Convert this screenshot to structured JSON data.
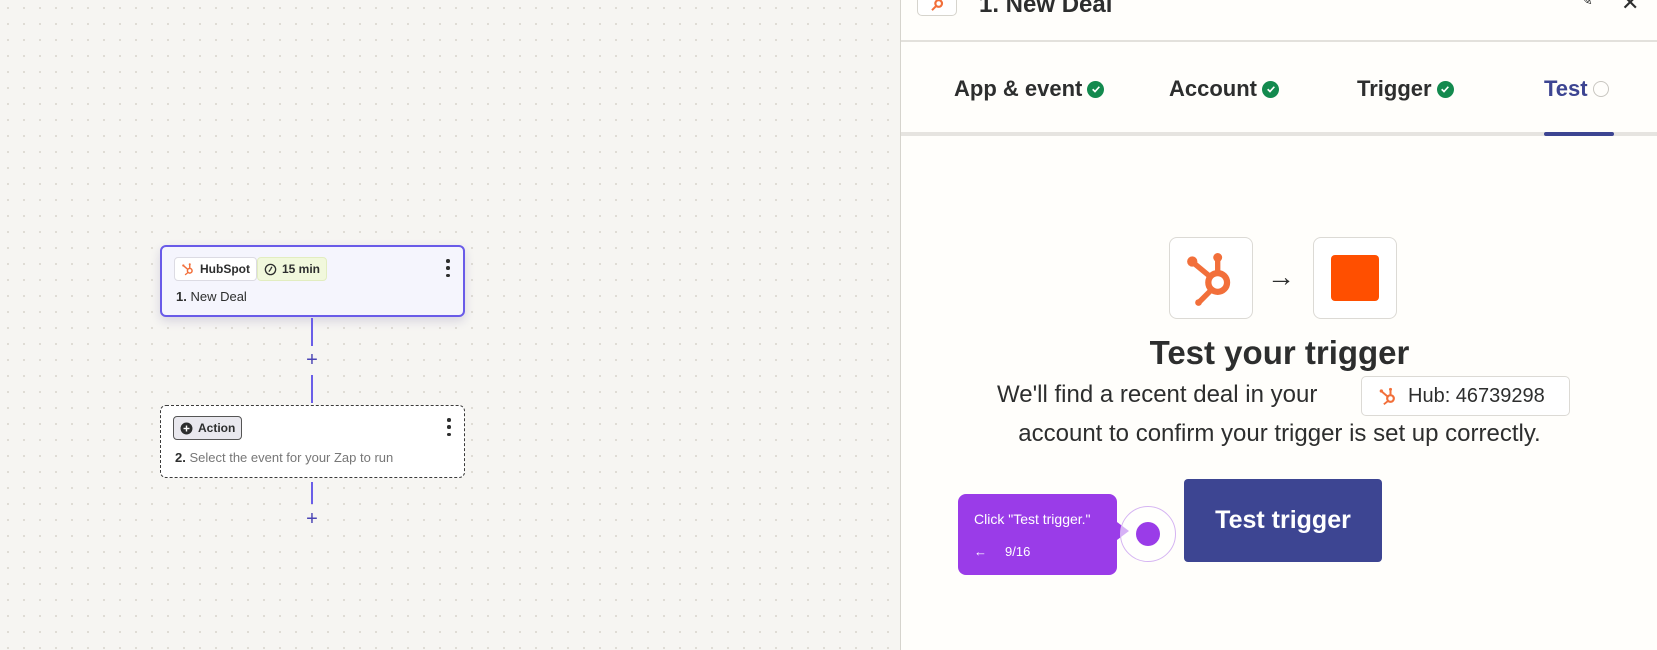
{
  "canvas": {
    "trigger_node": {
      "app_name": "HubSpot",
      "schedule": "15 min",
      "step_number": "1.",
      "step_title": "New Deal"
    },
    "action_node": {
      "badge": "Action",
      "step_number": "2.",
      "step_title": "Select the event for your Zap to run"
    },
    "add_step_symbol": "+"
  },
  "panel": {
    "header": {
      "title": "1. New Deal"
    },
    "tabs": [
      {
        "label": "App & event",
        "status": "complete"
      },
      {
        "label": "Account",
        "status": "complete"
      },
      {
        "label": "Trigger",
        "status": "complete"
      },
      {
        "label": "Test",
        "status": "pending"
      }
    ],
    "arrow": "→",
    "heading": "Test your trigger",
    "desc_line1": "We'll find a recent deal in your",
    "hub_label": "Hub: 46739298",
    "desc_line2": "account to confirm your trigger is set up correctly.",
    "test_button": "Test trigger"
  },
  "tooltip": {
    "text": "Click \"Test trigger.\"",
    "back": "←",
    "progress": "9/16"
  },
  "colors": {
    "accent": "#3d4592",
    "node_border": "#695be8",
    "hubspot": "#f26f3a",
    "zapier": "#ff4f00",
    "success": "#138a4e",
    "tooltip": "#9a3ce8"
  }
}
